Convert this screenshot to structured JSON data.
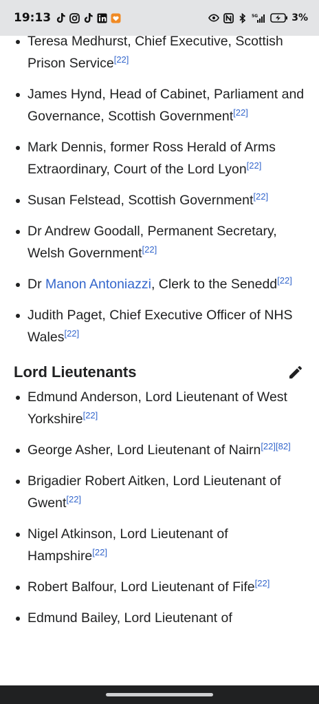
{
  "status_bar": {
    "time": "19:13",
    "left_icons": [
      "tiktok-icon",
      "instagram-icon",
      "tiktok-icon",
      "linkedin-icon",
      "heart-app-icon"
    ],
    "right_icons": [
      "eye-icon",
      "nfc-icon",
      "bluetooth-icon",
      "signal-5g-icon",
      "battery-charging-icon"
    ],
    "network": "5G",
    "battery": "3%"
  },
  "first_list": [
    {
      "text": "Teresa Medhurst, Chief Executive, Scottish Prison Service",
      "refs": [
        "[22]"
      ]
    },
    {
      "text": "James Hynd, Head of Cabinet, Parliament and Governance, Scottish Government",
      "refs": [
        "[22]"
      ]
    },
    {
      "text": "Mark Dennis, former Ross Herald of Arms Extraordinary, Court of the Lord Lyon",
      "refs": [
        "[22]"
      ]
    },
    {
      "text": "Susan Felstead, Scottish Government",
      "refs": [
        "[22]"
      ]
    },
    {
      "text": "Dr Andrew Goodall, Permanent Secretary, Welsh Government",
      "refs": [
        "[22]"
      ]
    },
    {
      "prefix": "Dr ",
      "link": "Manon Antoniazzi",
      "text": ", Clerk to the Senedd",
      "refs": [
        "[22]"
      ]
    },
    {
      "text": "Judith Paget, Chief Executive Officer of NHS Wales",
      "refs": [
        "[22]"
      ]
    }
  ],
  "section": {
    "title": "Lord Lieutenants",
    "edit_icon": "pencil-icon"
  },
  "second_list": [
    {
      "text": "Edmund Anderson, Lord Lieutenant of West Yorkshire",
      "refs": [
        "[22]"
      ]
    },
    {
      "text": "George Asher, Lord Lieutenant of Nairn",
      "refs": [
        "[22]",
        "[82]"
      ]
    },
    {
      "text": "Brigadier Robert Aitken, Lord Lieutenant of Gwent",
      "refs": [
        "[22]"
      ]
    },
    {
      "text": "Nigel Atkinson, Lord Lieutenant of Hampshire",
      "refs": [
        "[22]"
      ]
    },
    {
      "text": "Robert Balfour, Lord Lieutenant of Fife",
      "refs": [
        "[22]"
      ]
    },
    {
      "text": "Edmund Bailey, Lord Lieutenant of",
      "refs": []
    }
  ],
  "colors": {
    "link": "#3366cc",
    "text": "#202122",
    "status_bar_bg": "#e3e4e6",
    "nav_bar_bg": "#202122"
  }
}
